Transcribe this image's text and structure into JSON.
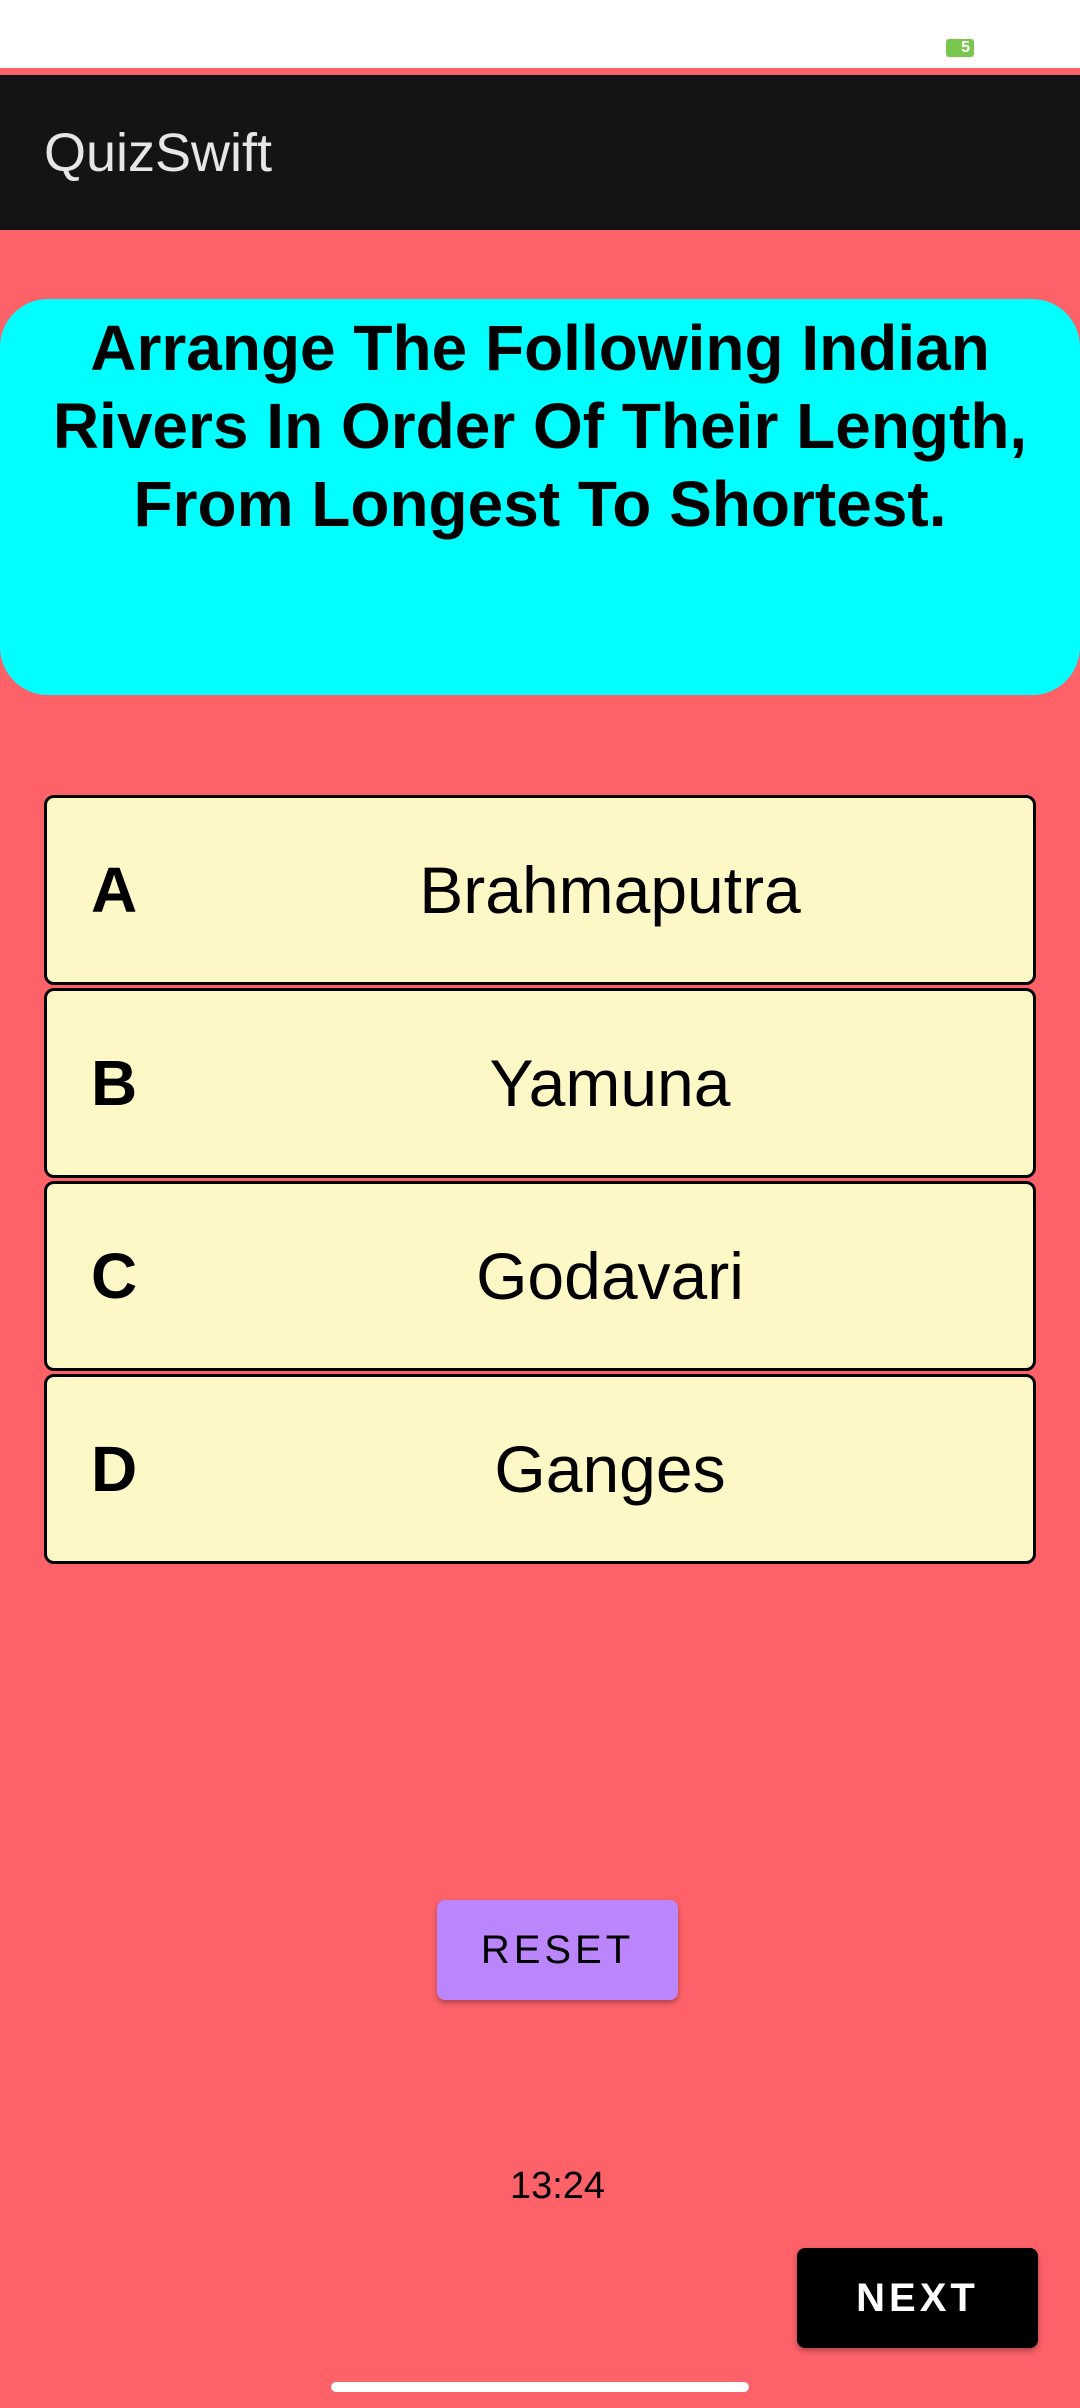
{
  "status_bar": {
    "battery_level": "5",
    "battery_color": "#7ac74f"
  },
  "app_bar": {
    "title": "QuizSwift"
  },
  "question": {
    "text": "Arrange The Following Indian Rivers In Order Of Their Length, From Longest To Shortest.",
    "background_color": "#00ffff"
  },
  "options": [
    {
      "letter": "A",
      "text": "Brahmaputra"
    },
    {
      "letter": "B",
      "text": "Yamuna"
    },
    {
      "letter": "C",
      "text": "Godavari"
    },
    {
      "letter": "D",
      "text": "Ganges"
    }
  ],
  "controls": {
    "reset_label": "RESET",
    "next_label": "NEXT",
    "timer": "13:24"
  },
  "colors": {
    "background": "#fd6269",
    "option_fill": "#fdf8c5",
    "reset_button": "#bb86fc",
    "next_button": "#000000"
  }
}
